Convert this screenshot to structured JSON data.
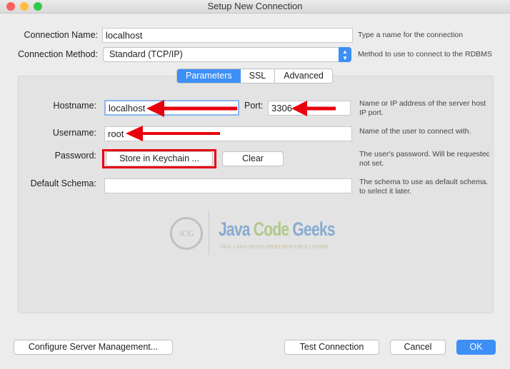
{
  "window": {
    "title": "Setup New Connection"
  },
  "form": {
    "connection_name": {
      "label": "Connection Name:",
      "value": "localhost",
      "hint": "Type a name for the connection"
    },
    "connection_method": {
      "label": "Connection Method:",
      "value": "Standard (TCP/IP)",
      "hint": "Method to use to connect to the RDBMS"
    }
  },
  "tabs": [
    {
      "label": "Parameters",
      "active": true
    },
    {
      "label": "SSL"
    },
    {
      "label": "Advanced"
    }
  ],
  "params": {
    "hostname": {
      "label": "Hostname:",
      "value": "localhost",
      "hint1": "Name or IP address of the server host",
      "hint2": "IP port."
    },
    "port": {
      "label": "Port:",
      "value": "3306"
    },
    "username": {
      "label": "Username:",
      "value": "root",
      "hint": "Name of the user to connect with."
    },
    "password": {
      "label": "Password:",
      "store_label": "Store in Keychain ...",
      "clear_label": "Clear",
      "hint1": "The user's password. Will be requested later if it's",
      "hint2": "not set."
    },
    "default_schema": {
      "label": "Default Schema:",
      "value": "",
      "hint1": "The schema to use as default schema. Leave blank",
      "hint2": "to select it later."
    }
  },
  "watermark": {
    "text": "Java Code Geeks",
    "tagline": "Java 2 Java Developers Resource Center",
    "badge": "JCG"
  },
  "footer": {
    "configure": "Configure Server Management...",
    "test": "Test Connection",
    "cancel": "Cancel",
    "ok": "OK"
  },
  "colors": {
    "accent": "#3d8ff5",
    "annotation": "#e8000d"
  }
}
